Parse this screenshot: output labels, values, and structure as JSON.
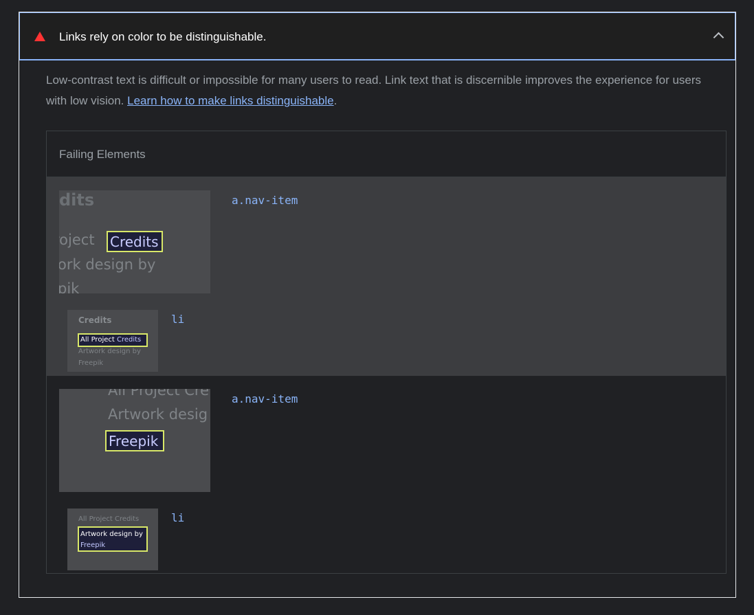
{
  "audit": {
    "title": "Links rely on color to be distinguishable.",
    "status_icon": "fail-triangle-icon",
    "status_color": "#ff3333",
    "accent_color": "#8ab4f8",
    "description_text": "Low-contrast text is difficult or impossible for many users to read. Link text that is discernible improves the experience for users with low vision. ",
    "description_link": "Learn how to make links distinguishable",
    "description_end": "."
  },
  "details": {
    "heading": "Failing Elements",
    "items": [
      {
        "selector": "a.nav-item",
        "sub_selector": "li",
        "large_shot": {
          "heading": "dits",
          "line1_prefix": "roject",
          "line1_highlight": "Credits",
          "line2": "ork design by",
          "line3": "pik"
        },
        "small_shot": {
          "heading": "Credits",
          "highlight_prefix": "All Project",
          "highlight_link": "Credits",
          "line2": "Artwork design by",
          "line3": "Freepik"
        }
      },
      {
        "selector": "a.nav-item",
        "sub_selector": "li",
        "large_shot": {
          "line1": "All Project Cre",
          "line2": "Artwork desig",
          "highlight": "Freepik"
        },
        "small_shot": {
          "line1": "All Project Credits",
          "highlight_line1": "Artwork design by",
          "highlight_line2": "Freepik"
        }
      }
    ]
  }
}
